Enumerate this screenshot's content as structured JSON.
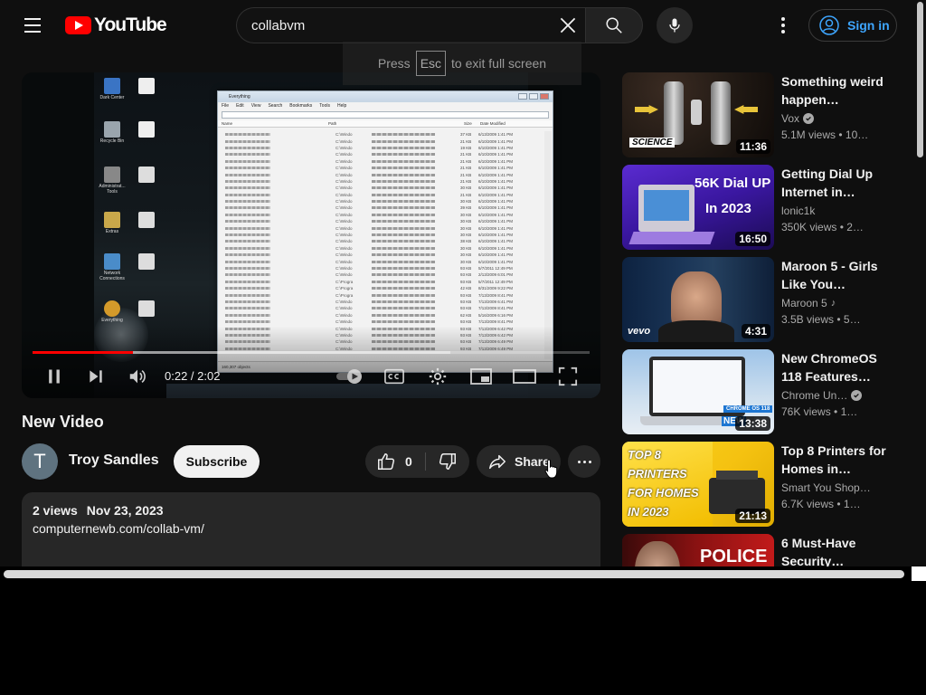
{
  "header": {
    "logo_text": "YouTube",
    "search_value": "collabvm",
    "signin_label": "Sign in"
  },
  "fullscreen_hint": {
    "before": "Press",
    "key": "Esc",
    "after": "to exit full screen"
  },
  "player": {
    "time_display": "0:22 / 2:02",
    "progress_fraction": 0.18,
    "loaded_fraction": 0.75,
    "window_title": "Everything",
    "window_menu": [
      "File",
      "Edit",
      "View",
      "Search",
      "Bookmarks",
      "Tools",
      "Help"
    ],
    "window_columns": [
      "Name",
      "Path",
      "Size",
      "Date Modified"
    ],
    "window_status": "160,307 objects",
    "row_paths": [
      "C:\\Windo",
      "C:\\Windo",
      "C:\\Windo",
      "C:\\Windo",
      "C:\\Windo",
      "C:\\Windo",
      "C:\\Windo",
      "C:\\Windo",
      "C:\\Windo",
      "C:\\Windo",
      "C:\\Windo",
      "C:\\Windo",
      "C:\\Windo",
      "C:\\Windo",
      "C:\\Windo",
      "C:\\Windo",
      "C:\\Windo",
      "C:\\Windo",
      "C:\\Windo",
      "C:\\Windo",
      "C:\\Windo",
      "C:\\Windo",
      "C:\\Progra",
      "C:\\Progra",
      "C:\\Progra",
      "C:\\Windo",
      "C:\\Windo",
      "C:\\Windo",
      "C:\\Windo",
      "C:\\Windo",
      "C:\\Windo",
      "C:\\Windo",
      "C:\\Windo"
    ],
    "row_sizes": [
      "37 KB",
      "21 KB",
      "19 KB",
      "21 KB",
      "21 KB",
      "21 KB",
      "21 KB",
      "21 KB",
      "30 KB",
      "21 KB",
      "30 KB",
      "39 KB",
      "30 KB",
      "30 KB",
      "30 KB",
      "30 KB",
      "38 KB",
      "30 KB",
      "30 KB",
      "30 KB",
      "93 KB",
      "93 KB",
      "93 KB",
      "42 KB",
      "93 KB",
      "93 KB",
      "93 KB",
      "62 KB",
      "93 KB",
      "93 KB",
      "93 KB",
      "93 KB",
      "93 KB"
    ],
    "row_dates": [
      "6/13/2009 1:41 PM",
      "6/10/2009 1:41 PM",
      "6/10/2009 1:41 PM",
      "6/10/2009 1:41 PM",
      "6/10/2009 1:41 PM",
      "6/10/2009 1:41 PM",
      "6/10/2009 1:41 PM",
      "6/10/2009 1:41 PM",
      "6/10/2009 1:41 PM",
      "6/10/2009 1:41 PM",
      "6/10/2009 1:41 PM",
      "6/10/2009 1:41 PM",
      "6/10/2009 1:41 PM",
      "6/10/2009 1:41 PM",
      "6/10/2009 1:41 PM",
      "6/10/2009 1:41 PM",
      "6/10/2009 1:41 PM",
      "6/10/2009 1:41 PM",
      "6/10/2009 1:41 PM",
      "6/10/2009 1:41 PM",
      "5/7/2011 12:49 PM",
      "2/13/2009 6:01 PM",
      "5/7/2011 12:49 PM",
      "8/31/2009 9:22 PM",
      "7/13/2009 8:41 PM",
      "7/13/2009 6:41 PM",
      "7/13/2009 8:41 PM",
      "5/16/2009 6:16 PM",
      "7/13/2009 8:41 PM",
      "7/13/2009 6:42 PM",
      "7/13/2009 6:42 PM",
      "7/13/2009 6:49 PM",
      "7/13/2009 6:49 PM"
    ],
    "desktop_icons": [
      "Dark Center",
      "Recycle Bin",
      "Administrat... Tools",
      "Extras",
      "Network Connections",
      "Everything"
    ]
  },
  "video": {
    "title": "New Video",
    "channel_initial": "T",
    "channel_name": "Troy Sandles",
    "subscribe_label": "Subscribe",
    "like_count": "0",
    "share_label": "Share",
    "views": "2 views",
    "date": "Nov 23, 2023",
    "description_link": "computernewb.com/collab-vm/"
  },
  "recommendations": [
    {
      "title": "Something weird happen…",
      "channel": "Vox",
      "verified": true,
      "music": false,
      "views": "5.1M views",
      "age": "10…",
      "duration": "11:36",
      "thumb_text": "SCIENCE",
      "thumb_text2": ""
    },
    {
      "title": "Getting Dial Up Internet in…",
      "channel": "lonic1k",
      "verified": false,
      "music": false,
      "views": "350K views",
      "age": "2…",
      "duration": "16:50",
      "thumb_text": "56K Dial UP",
      "thumb_text2": "In 2023"
    },
    {
      "title": "Maroon 5 - Girls Like You…",
      "channel": "Maroon 5",
      "verified": false,
      "music": true,
      "views": "3.5B views",
      "age": "5…",
      "duration": "4:31",
      "thumb_text": "vevo",
      "thumb_text2": ""
    },
    {
      "title": "New ChromeOS 118 Features…",
      "channel": "Chrome Un…",
      "verified": true,
      "music": false,
      "views": "76K views",
      "age": "1…",
      "duration": "13:38",
      "thumb_text": "CHROME OS 118",
      "thumb_text2": "NEW"
    },
    {
      "title": "Top 8 Printers for Homes in…",
      "channel": "Smart You Shop…",
      "verified": false,
      "music": false,
      "views": "6.7K views",
      "age": "1…",
      "duration": "21:13",
      "thumb_text": "TOP 8 PRINTERS FOR HOMES IN 2023",
      "thumb_text2": ""
    },
    {
      "title": "6 Must-Have Security…",
      "channel": "",
      "verified": false,
      "music": false,
      "views": "",
      "age": "",
      "duration": "",
      "thumb_text": "POLICE",
      "thumb_text2": ""
    }
  ],
  "colors": {
    "background": "#0f0f0f",
    "brand_red": "#ff0000",
    "link_blue": "#3ea6ff",
    "chip_bg": "#272727"
  }
}
